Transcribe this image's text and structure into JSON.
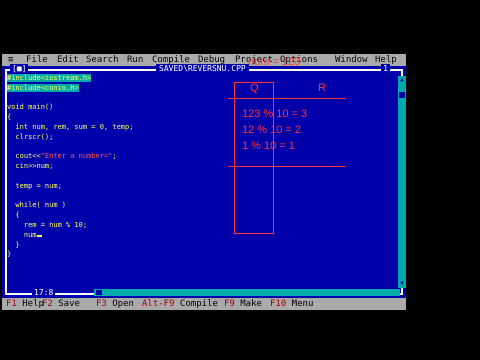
{
  "menu": {
    "system": "≡",
    "items": [
      "File",
      "Edit",
      "Search",
      "Run",
      "Compile",
      "Debug",
      "Project",
      "Options",
      "Window",
      "Help"
    ]
  },
  "editor": {
    "close_box": "[■]",
    "filename": "SAVED\\REVERSNU.CPP",
    "window_number": "1",
    "cursor_position": "17:8",
    "code_lines": [
      {
        "parts": [
          {
            "t": "#include<iostream.h>",
            "c": "inc"
          }
        ]
      },
      {
        "parts": [
          {
            "t": "#include<conio.h>",
            "c": "inc"
          }
        ]
      },
      {
        "parts": [
          {
            "t": "",
            "c": ""
          }
        ]
      },
      {
        "parts": [
          {
            "t": "void main()",
            "c": ""
          }
        ]
      },
      {
        "parts": [
          {
            "t": "{",
            "c": ""
          }
        ]
      },
      {
        "parts": [
          {
            "t": "  int num, rem, sum = 0, temp;",
            "c": ""
          }
        ]
      },
      {
        "parts": [
          {
            "t": "  clrscr();",
            "c": ""
          }
        ]
      },
      {
        "parts": [
          {
            "t": "",
            "c": ""
          }
        ]
      },
      {
        "parts": [
          {
            "t": "  cout<<",
            "c": ""
          },
          {
            "t": "\"Enter a number=\"",
            "c": "str"
          },
          {
            "t": ";",
            "c": ""
          }
        ]
      },
      {
        "parts": [
          {
            "t": "  cin>>num;",
            "c": ""
          }
        ]
      },
      {
        "parts": [
          {
            "t": "",
            "c": ""
          }
        ]
      },
      {
        "parts": [
          {
            "t": "  temp = num;",
            "c": ""
          }
        ]
      },
      {
        "parts": [
          {
            "t": "",
            "c": ""
          }
        ]
      },
      {
        "parts": [
          {
            "t": "  while( num )",
            "c": ""
          }
        ]
      },
      {
        "parts": [
          {
            "t": "  {",
            "c": ""
          }
        ]
      },
      {
        "parts": [
          {
            "t": "    rem = num % 10;",
            "c": ""
          }
        ]
      },
      {
        "parts": [
          {
            "t": "    num",
            "c": ""
          },
          {
            "t": "",
            "c": "cursor"
          }
        ]
      },
      {
        "parts": [
          {
            "t": "  }",
            "c": ""
          }
        ]
      },
      {
        "parts": [
          {
            "t": "}",
            "c": ""
          }
        ]
      }
    ]
  },
  "annotation": {
    "title": "num = 123",
    "header_q": "Q",
    "header_r": "R",
    "rows": [
      "123 % 10 = 3",
      "12 % 10  = 2",
      "1 % 10   = 1"
    ]
  },
  "status": {
    "items": [
      {
        "key": "F1",
        "label": " Help"
      },
      {
        "key": "F2",
        "label": " Save"
      },
      {
        "key": "F3",
        "label": " Open"
      },
      {
        "key": "Alt-F9",
        "label": " Compile"
      },
      {
        "key": "F9",
        "label": " Make"
      },
      {
        "key": "F10",
        "label": " Menu"
      }
    ]
  },
  "colors": {
    "editor_bg": "#0000aa",
    "menu_bg": "#aaaaaa",
    "hotkey": "#a00000",
    "code_text": "#ffff55",
    "string_text": "#ff5555",
    "annotation": "#ff3333"
  }
}
